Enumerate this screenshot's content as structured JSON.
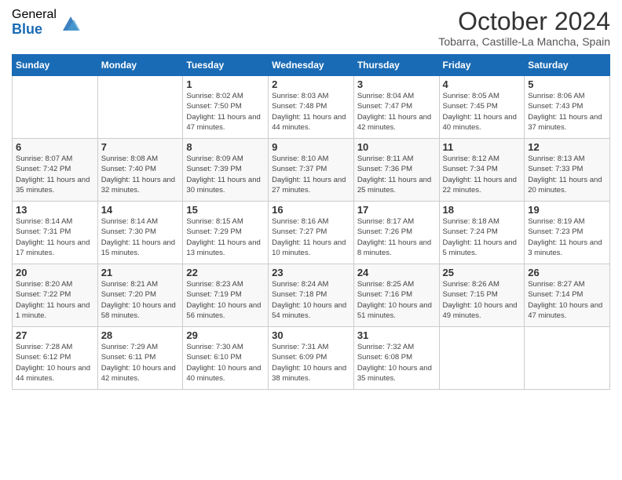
{
  "logo": {
    "general": "General",
    "blue": "Blue"
  },
  "header": {
    "month": "October 2024",
    "location": "Tobarra, Castille-La Mancha, Spain"
  },
  "weekdays": [
    "Sunday",
    "Monday",
    "Tuesday",
    "Wednesday",
    "Thursday",
    "Friday",
    "Saturday"
  ],
  "weeks": [
    [
      {
        "day": "",
        "info": ""
      },
      {
        "day": "",
        "info": ""
      },
      {
        "day": "1",
        "info": "Sunrise: 8:02 AM\nSunset: 7:50 PM\nDaylight: 11 hours and 47 minutes."
      },
      {
        "day": "2",
        "info": "Sunrise: 8:03 AM\nSunset: 7:48 PM\nDaylight: 11 hours and 44 minutes."
      },
      {
        "day": "3",
        "info": "Sunrise: 8:04 AM\nSunset: 7:47 PM\nDaylight: 11 hours and 42 minutes."
      },
      {
        "day": "4",
        "info": "Sunrise: 8:05 AM\nSunset: 7:45 PM\nDaylight: 11 hours and 40 minutes."
      },
      {
        "day": "5",
        "info": "Sunrise: 8:06 AM\nSunset: 7:43 PM\nDaylight: 11 hours and 37 minutes."
      }
    ],
    [
      {
        "day": "6",
        "info": "Sunrise: 8:07 AM\nSunset: 7:42 PM\nDaylight: 11 hours and 35 minutes."
      },
      {
        "day": "7",
        "info": "Sunrise: 8:08 AM\nSunset: 7:40 PM\nDaylight: 11 hours and 32 minutes."
      },
      {
        "day": "8",
        "info": "Sunrise: 8:09 AM\nSunset: 7:39 PM\nDaylight: 11 hours and 30 minutes."
      },
      {
        "day": "9",
        "info": "Sunrise: 8:10 AM\nSunset: 7:37 PM\nDaylight: 11 hours and 27 minutes."
      },
      {
        "day": "10",
        "info": "Sunrise: 8:11 AM\nSunset: 7:36 PM\nDaylight: 11 hours and 25 minutes."
      },
      {
        "day": "11",
        "info": "Sunrise: 8:12 AM\nSunset: 7:34 PM\nDaylight: 11 hours and 22 minutes."
      },
      {
        "day": "12",
        "info": "Sunrise: 8:13 AM\nSunset: 7:33 PM\nDaylight: 11 hours and 20 minutes."
      }
    ],
    [
      {
        "day": "13",
        "info": "Sunrise: 8:14 AM\nSunset: 7:31 PM\nDaylight: 11 hours and 17 minutes."
      },
      {
        "day": "14",
        "info": "Sunrise: 8:14 AM\nSunset: 7:30 PM\nDaylight: 11 hours and 15 minutes."
      },
      {
        "day": "15",
        "info": "Sunrise: 8:15 AM\nSunset: 7:29 PM\nDaylight: 11 hours and 13 minutes."
      },
      {
        "day": "16",
        "info": "Sunrise: 8:16 AM\nSunset: 7:27 PM\nDaylight: 11 hours and 10 minutes."
      },
      {
        "day": "17",
        "info": "Sunrise: 8:17 AM\nSunset: 7:26 PM\nDaylight: 11 hours and 8 minutes."
      },
      {
        "day": "18",
        "info": "Sunrise: 8:18 AM\nSunset: 7:24 PM\nDaylight: 11 hours and 5 minutes."
      },
      {
        "day": "19",
        "info": "Sunrise: 8:19 AM\nSunset: 7:23 PM\nDaylight: 11 hours and 3 minutes."
      }
    ],
    [
      {
        "day": "20",
        "info": "Sunrise: 8:20 AM\nSunset: 7:22 PM\nDaylight: 11 hours and 1 minute."
      },
      {
        "day": "21",
        "info": "Sunrise: 8:21 AM\nSunset: 7:20 PM\nDaylight: 10 hours and 58 minutes."
      },
      {
        "day": "22",
        "info": "Sunrise: 8:23 AM\nSunset: 7:19 PM\nDaylight: 10 hours and 56 minutes."
      },
      {
        "day": "23",
        "info": "Sunrise: 8:24 AM\nSunset: 7:18 PM\nDaylight: 10 hours and 54 minutes."
      },
      {
        "day": "24",
        "info": "Sunrise: 8:25 AM\nSunset: 7:16 PM\nDaylight: 10 hours and 51 minutes."
      },
      {
        "day": "25",
        "info": "Sunrise: 8:26 AM\nSunset: 7:15 PM\nDaylight: 10 hours and 49 minutes."
      },
      {
        "day": "26",
        "info": "Sunrise: 8:27 AM\nSunset: 7:14 PM\nDaylight: 10 hours and 47 minutes."
      }
    ],
    [
      {
        "day": "27",
        "info": "Sunrise: 7:28 AM\nSunset: 6:12 PM\nDaylight: 10 hours and 44 minutes."
      },
      {
        "day": "28",
        "info": "Sunrise: 7:29 AM\nSunset: 6:11 PM\nDaylight: 10 hours and 42 minutes."
      },
      {
        "day": "29",
        "info": "Sunrise: 7:30 AM\nSunset: 6:10 PM\nDaylight: 10 hours and 40 minutes."
      },
      {
        "day": "30",
        "info": "Sunrise: 7:31 AM\nSunset: 6:09 PM\nDaylight: 10 hours and 38 minutes."
      },
      {
        "day": "31",
        "info": "Sunrise: 7:32 AM\nSunset: 6:08 PM\nDaylight: 10 hours and 35 minutes."
      },
      {
        "day": "",
        "info": ""
      },
      {
        "day": "",
        "info": ""
      }
    ]
  ]
}
